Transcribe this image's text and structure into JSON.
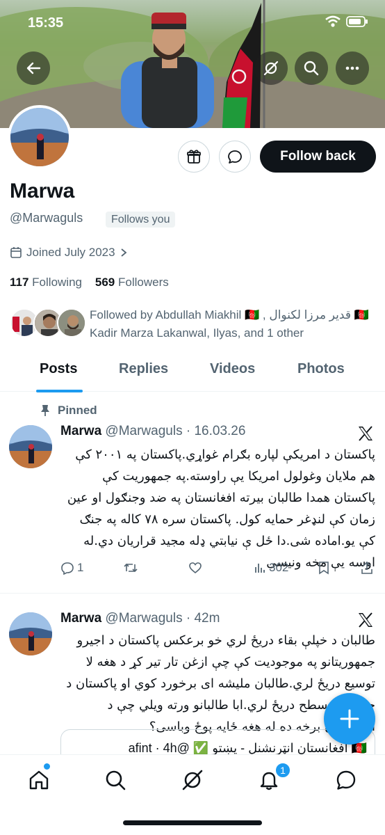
{
  "status_bar": {
    "time": "15:35"
  },
  "profile": {
    "name": "Marwa",
    "handle": "@Marwaguls",
    "follows_you": "Follows you",
    "follow_back_label": "Follow back",
    "joined": "Joined July 2023",
    "following_count": "117",
    "following_label": "Following",
    "followers_count": "569",
    "followers_label": "Followers",
    "followed_by_text": "Followed by Abdullah Miakhil 🇦🇫 , قدير مرزا لکنوال 🇦🇫 Kadir Marza Lakanwal, Ilyas, and 1 other"
  },
  "tabs": [
    {
      "label": "Posts",
      "active": true
    },
    {
      "label": "Replies"
    },
    {
      "label": "Videos"
    },
    {
      "label": "Photos"
    }
  ],
  "posts": [
    {
      "pinned_label": "Pinned",
      "author": "Marwa",
      "meta": "@Marwaguls · 16.03.26",
      "text": "پاکستان د امریکې لپاره بګرام غواړي.پاکستان په ۲۰۰۱ کې هم ملايان وغولول امریکا یې راوسته.په جمهوریت کې پاکستان همدا طالبان بیرته افغانستان په ضد وجنګول او عین زمان کې لنډغر حمایه کول. پاکستان سره ۷۸ کاله په جنګ کې یو.اماده شی.دا ځل ې نیابتي ډله مجید قراریان دي.له اوسه یې مخه ونیسی",
      "replies": "1",
      "reposts": "",
      "likes": "",
      "views": "302"
    },
    {
      "author": "Marwa",
      "meta": "@Marwaguls · 42m",
      "text": "طالبان د خپلې بقاء دریځ لري خو برعکس پاکستان د اجیرو جمهوریتانو په موجودیت کې چې ازغن تار تیر کړ د هغه لا توسیع دریځ لري.طالبان ملیشه ای برخورد کوي او پاکستان د حملې په سطح دریځ لري.ابا طالبانو ورته ویلي چې د افغانستان برخه ده له هغه ځایه پوځ وباسی؟",
      "quote_text": "🇦🇫 افغانستان انټرنشنل - پښتو ✅ @afint · 4h"
    }
  ],
  "nav": {
    "notifications_badge": "1"
  },
  "colors": {
    "accent": "#1d9bf0",
    "text": "#0f1419",
    "muted": "#536471"
  }
}
